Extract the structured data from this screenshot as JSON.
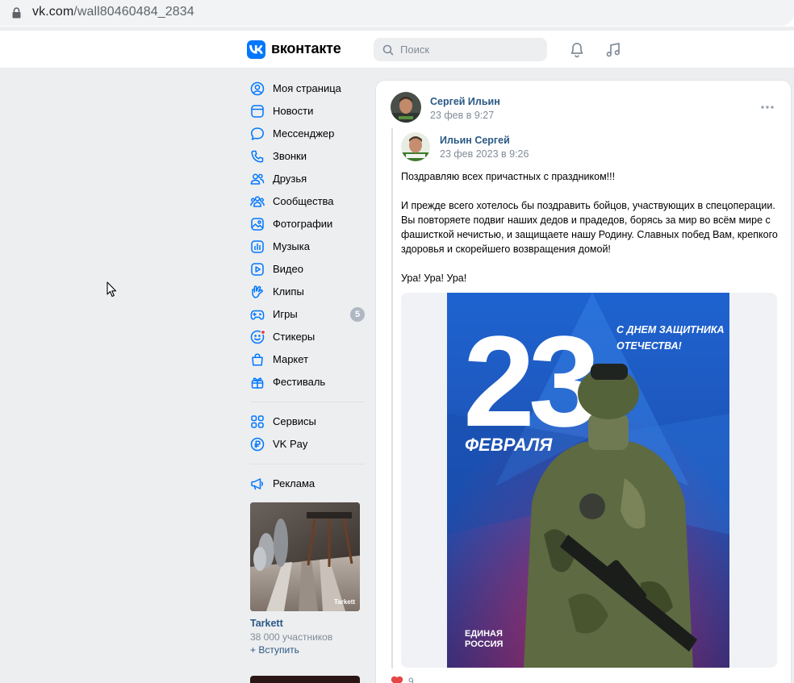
{
  "browser": {
    "url_host": "vk.com",
    "url_path": "/wall80460484_2834"
  },
  "header": {
    "logo_text": "вконтакте",
    "search_placeholder": "Поиск"
  },
  "menu": {
    "items": [
      {
        "label": "Моя страница",
        "icon": "user-circle-icon"
      },
      {
        "label": "Новости",
        "icon": "newsfeed-icon"
      },
      {
        "label": "Мессенджер",
        "icon": "message-icon"
      },
      {
        "label": "Звонки",
        "icon": "phone-icon"
      },
      {
        "label": "Друзья",
        "icon": "friends-icon"
      },
      {
        "label": "Сообщества",
        "icon": "communities-icon"
      },
      {
        "label": "Фотографии",
        "icon": "photo-icon"
      },
      {
        "label": "Музыка",
        "icon": "music-icon"
      },
      {
        "label": "Видео",
        "icon": "video-icon"
      },
      {
        "label": "Клипы",
        "icon": "clips-icon"
      },
      {
        "label": "Игры",
        "icon": "games-icon",
        "badge": "5"
      },
      {
        "label": "Стикеры",
        "icon": "stickers-icon"
      },
      {
        "label": "Маркет",
        "icon": "market-icon"
      },
      {
        "label": "Фестиваль",
        "icon": "festival-icon"
      }
    ],
    "secondary": [
      {
        "label": "Сервисы",
        "icon": "services-icon"
      },
      {
        "label": "VK Pay",
        "icon": "vkpay-icon"
      }
    ],
    "tertiary": [
      {
        "label": "Реклама",
        "icon": "ads-icon"
      }
    ]
  },
  "promo": {
    "brand": "Tarkett",
    "title": "Tarkett",
    "members": "38 000 участников",
    "join": "+ Вступить"
  },
  "post": {
    "author": "Сергей Ильин",
    "date": "23 фев в 9:27",
    "repost_author": "Ильин Сергей",
    "repost_date": "23 фев 2023 в 9:26",
    "paragraph1": "Поздравляю всех причастных с праздником!!!",
    "paragraph2": "И прежде всего хотелось бы поздравить бойцов, участвующих в спецоперации. Вы повторяете подвиг наших дедов и прадедов, борясь за мир во всём мире с фашисткой нечистью, и защищаете нашу Родину. Славных побед Вам, крепкого здоровья и скорейшего возвращения домой!",
    "paragraph3": "Ура! Ура! Ура!",
    "like_count": "9"
  },
  "poster": {
    "number": "23",
    "month": "ФЕВРАЛЯ",
    "greeting_line1": "С ДНЕМ ЗАЩИТНИКА",
    "greeting_line2": "ОТЕЧЕСТВА!",
    "party_line1": "ЕДИНАЯ",
    "party_line2": "РОССИЯ"
  },
  "colors": {
    "vk_blue": "#0077ff",
    "link": "#2a5885",
    "poster_blue": "#1a5fc8"
  }
}
